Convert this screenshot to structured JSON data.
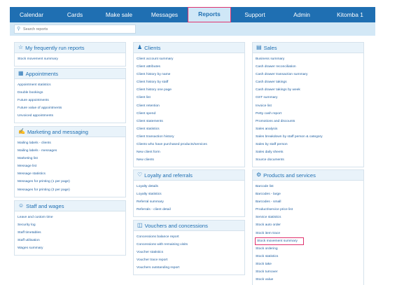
{
  "nav": {
    "items": [
      "Calendar",
      "Cards",
      "Make sale",
      "Messages",
      "Reports",
      "Support",
      "Admin",
      "Kitomba 1"
    ],
    "active": "Reports"
  },
  "search": {
    "placeholder": "Search reports"
  },
  "panels": {
    "frequent": {
      "title": "My frequently run reports",
      "icon": "star-icon",
      "links": [
        "Stock movement summary"
      ]
    },
    "appointments": {
      "title": "Appointments",
      "icon": "calendar-icon",
      "links": [
        "Appointment statistics",
        "Double bookings",
        "Future appointments",
        "Future value of appointments",
        "Unvoiced appointments"
      ]
    },
    "marketing": {
      "title": "Marketing and messaging",
      "icon": "chat-icon",
      "links": [
        "Mailing labels - clients",
        "Mailing labels - messages",
        "Marketing list",
        "Message list",
        "Message statistics",
        "Messages for printing (1 per page)",
        "Messages for printing (3 per page)"
      ]
    },
    "staff": {
      "title": "Staff and wages",
      "icon": "staff-icon",
      "links": [
        "Leave and custom time",
        "Security log",
        "Staff timetables",
        "Staff utilisation",
        "Wages summary"
      ]
    },
    "clients": {
      "title": "Clients",
      "icon": "people-icon",
      "links": [
        "Client account summary",
        "Client attributes",
        "Client history by name",
        "Client history by staff",
        "Client history one page",
        "Client list",
        "Client retention",
        "Client spend",
        "Client statements",
        "Client statistics",
        "Client transaction history",
        "Clients who have purchased products/services",
        "New client form",
        "New clients"
      ]
    },
    "loyalty": {
      "title": "Loyalty and referrals",
      "icon": "heart-icon",
      "links": [
        "Loyalty details",
        "Loyalty statistics",
        "Referral summary",
        "Referrals - client detail"
      ]
    },
    "vouchers": {
      "title": "Vouchers and concessions",
      "icon": "voucher-icon",
      "links": [
        "Concessions balance report",
        "Concessions with remaining visits",
        "Voucher statistics",
        "Voucher trace report",
        "Vouchers outstanding report"
      ]
    },
    "sales": {
      "title": "Sales",
      "icon": "sales-icon",
      "links": [
        "Business summary",
        "Cash drawer reconciliation",
        "Cash drawer transaction summary",
        "Cash drawer takings",
        "Cash drawer takings by week",
        "GST summary",
        "Invoice list",
        "Petty cash report",
        "Promotions and discounts",
        "Sales analysis",
        "Sales breakdown by staff person & category",
        "Sales by staff person",
        "Sales daily sheets",
        "Source documents"
      ]
    },
    "products": {
      "title": "Products and services",
      "icon": "products-icon",
      "links": [
        "Barcode list",
        "Barcodes - large",
        "Barcodes - small",
        "Product/service price list",
        "Service statistics",
        "Stock auto order",
        "Stock item trace",
        "Stock movement summary",
        "Stock ordering",
        "Stock statistics",
        "Stock take",
        "Stock turnover",
        "Stock value"
      ],
      "highlighted": "Stock movement summary"
    }
  }
}
